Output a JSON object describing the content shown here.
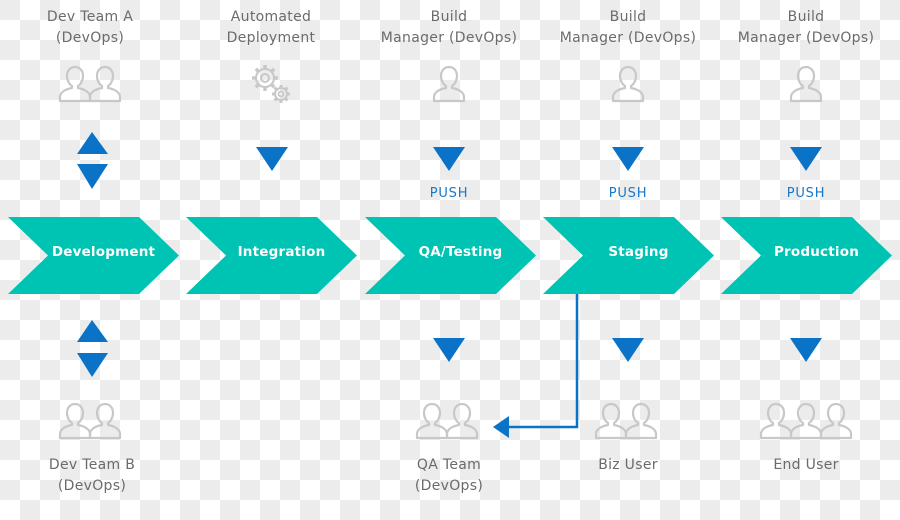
{
  "colors": {
    "stage_fill": "#00c4b3",
    "arrow_blue": "#0a73c8",
    "icon_gray": "#c8c8c8",
    "label_gray": "#6b6b6b"
  },
  "stages": [
    {
      "label": "Development"
    },
    {
      "label": "Integration"
    },
    {
      "label": "QA/Testing"
    },
    {
      "label": "Staging"
    },
    {
      "label": "Production"
    }
  ],
  "top_actors": [
    {
      "line1": "Dev Team A",
      "line2": "(DevOps)",
      "icon": "two-people-icon",
      "arrow": "bidirectional",
      "push": null
    },
    {
      "line1": "Automated",
      "line2": "Deployment",
      "icon": "gears-icon",
      "arrow": "down",
      "push": null
    },
    {
      "line1": "Build",
      "line2": "Manager (DevOps)",
      "icon": "person-icon",
      "arrow": "down",
      "push": "PUSH"
    },
    {
      "line1": "Build",
      "line2": "Manager (DevOps)",
      "icon": "person-icon",
      "arrow": "down",
      "push": "PUSH"
    },
    {
      "line1": "Build",
      "line2": "Manager (DevOps)",
      "icon": "person-icon",
      "arrow": "down",
      "push": "PUSH"
    }
  ],
  "bottom_actors": [
    {
      "line1": "Dev Team B",
      "line2": "(DevOps)",
      "icon": "two-people-icon",
      "arrow": "bidirectional"
    },
    null,
    {
      "line1": "QA Team",
      "line2": "(DevOps)",
      "icon": "two-people-icon",
      "arrow": "down"
    },
    {
      "line1": "Biz User",
      "line2": "",
      "icon": "two-people-icon",
      "arrow": "down"
    },
    {
      "line1": "End User",
      "line2": "",
      "icon": "three-people-icon",
      "arrow": "down"
    }
  ],
  "feedback_arrow": {
    "from": "Staging",
    "to": "QA Team",
    "direction": "left"
  }
}
